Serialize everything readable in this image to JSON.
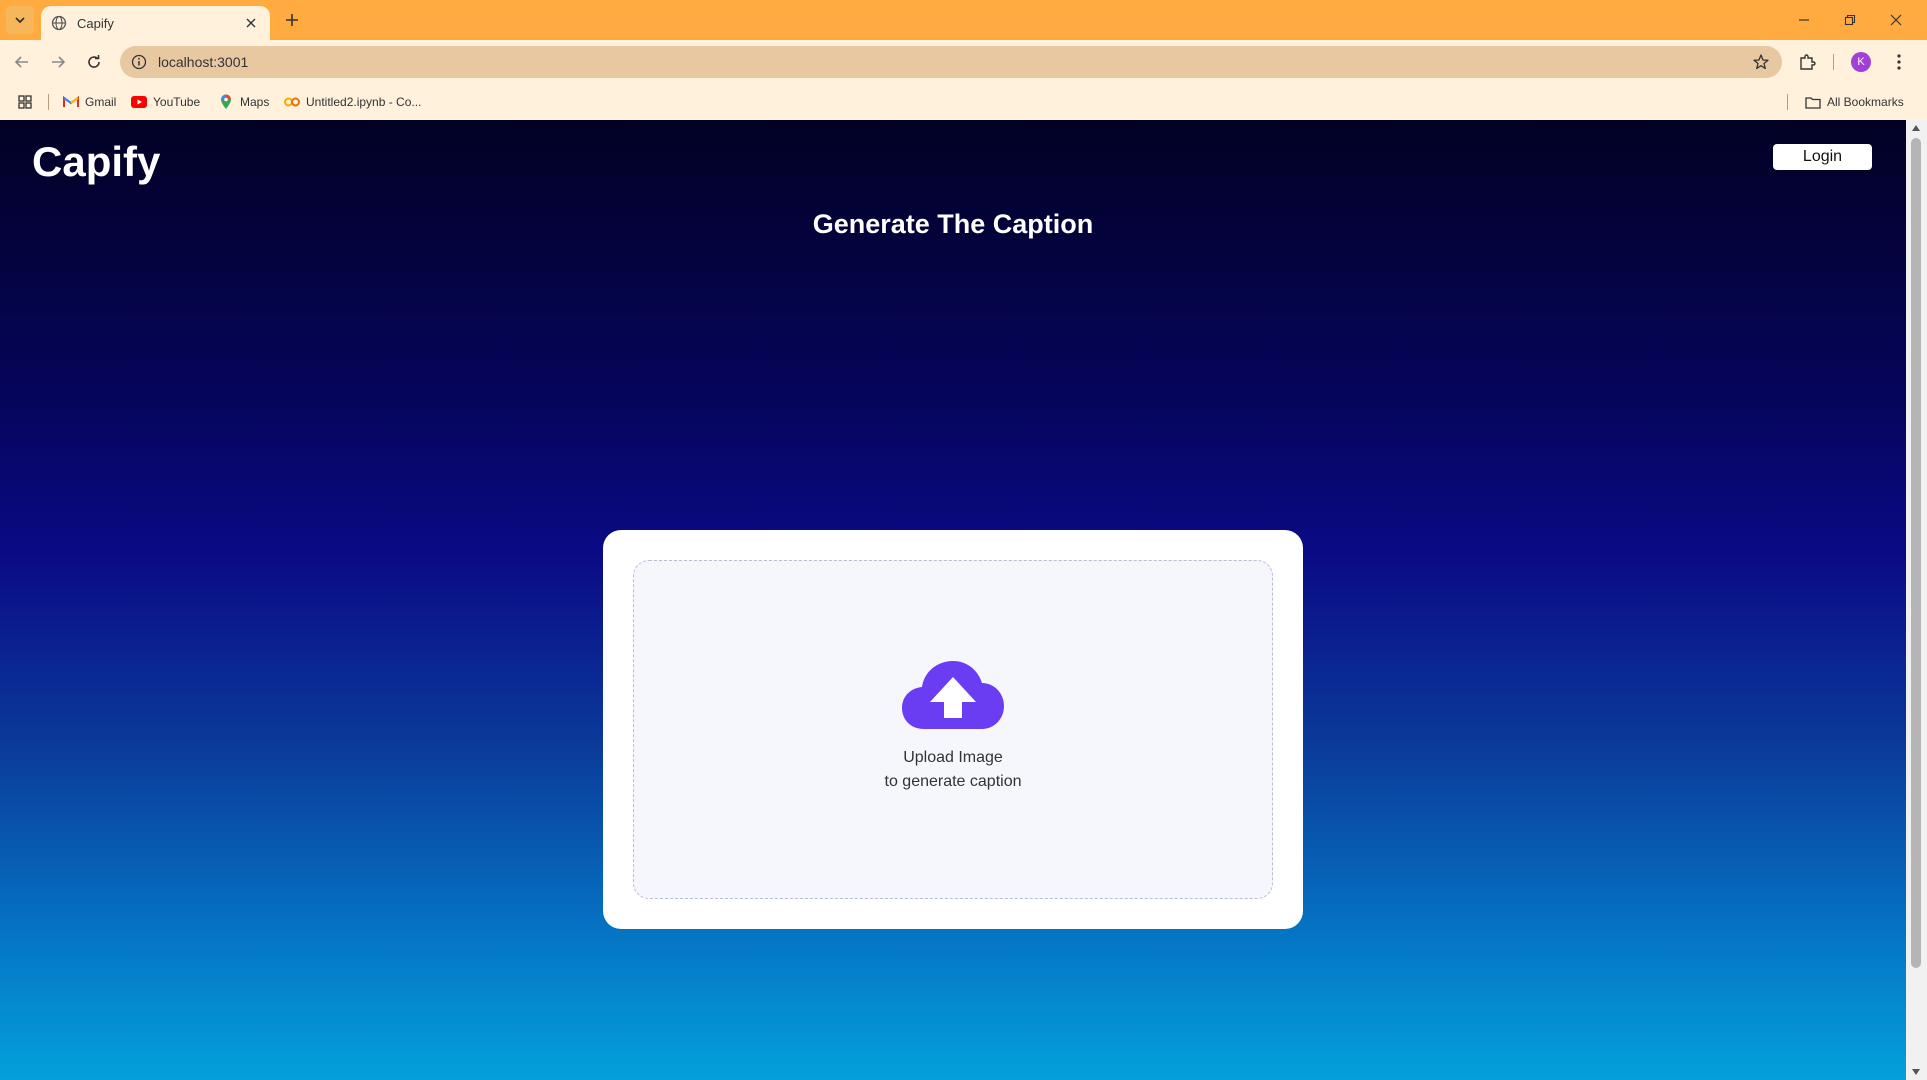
{
  "browser": {
    "tab_title": "Capify",
    "url": "localhost:3001",
    "profile_initial": "K",
    "bookmarks": [
      {
        "label": "Gmail",
        "icon": "gmail-icon"
      },
      {
        "label": "YouTube",
        "icon": "youtube-icon"
      },
      {
        "label": "Maps",
        "icon": "maps-icon"
      },
      {
        "label": "Untitled2.ipynb - Co...",
        "icon": "colab-icon"
      }
    ],
    "all_bookmarks_label": "All Bookmarks"
  },
  "app": {
    "brand": "Capify",
    "login_label": "Login",
    "heading": "Generate The Caption",
    "upload": {
      "title": "Upload Image",
      "subtitle": "to generate caption",
      "icon": "cloud-upload-icon"
    }
  },
  "colors": {
    "browser_accent": "#ffab40",
    "upload_icon": "#6b3df2",
    "gradient_top": "#020124",
    "gradient_bottom": "#04a0dc"
  }
}
